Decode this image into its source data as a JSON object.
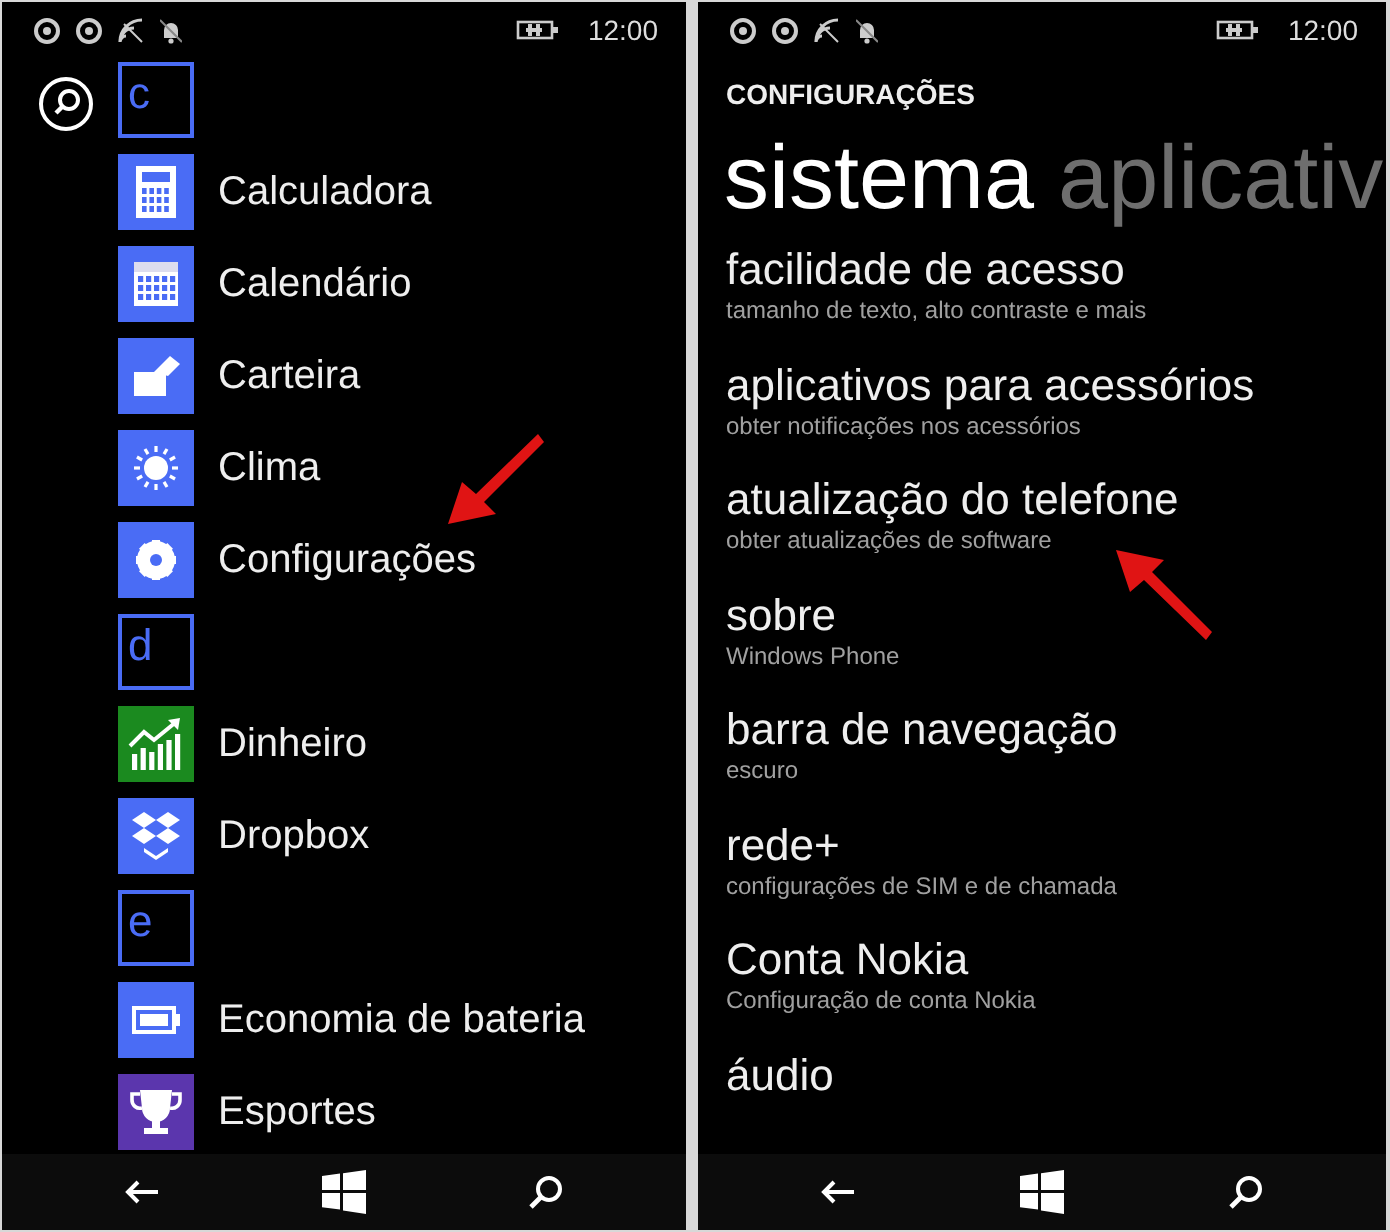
{
  "app_list_screen": {
    "status_bar": {
      "time": "12:00"
    },
    "apps": [
      {
        "kind": "letter",
        "label": "c",
        "color": "#4a6cf5"
      },
      {
        "kind": "app",
        "label": "Calculadora",
        "color": "#4a6cf5",
        "arrow": false
      },
      {
        "kind": "app",
        "label": "Calendário",
        "color": "#4a6cf5",
        "arrow": false
      },
      {
        "kind": "app",
        "label": "Carteira",
        "color": "#4a6cf5",
        "arrow": false
      },
      {
        "kind": "app",
        "label": "Clima",
        "color": "#4a6cf5",
        "arrow": false
      },
      {
        "kind": "app",
        "label": "Configurações",
        "color": "#4a6cf5",
        "arrow": true
      },
      {
        "kind": "letter",
        "label": "d",
        "color": "#4a6cf5"
      },
      {
        "kind": "app",
        "label": "Dinheiro",
        "color": "#1b8a1f",
        "arrow": false
      },
      {
        "kind": "app",
        "label": "Dropbox",
        "color": "#4a6cf5",
        "arrow": false
      },
      {
        "kind": "letter",
        "label": "e",
        "color": "#4a6cf5"
      },
      {
        "kind": "app",
        "label": "Economia de bateria",
        "color": "#4a6cf5",
        "arrow": false
      },
      {
        "kind": "app",
        "label": "Esportes",
        "color": "#5b36ad",
        "arrow": false
      }
    ]
  },
  "settings_screen": {
    "status_bar": {
      "time": "12:00"
    },
    "title": "CONFIGURAÇÕES",
    "pivots": [
      {
        "label": "sistema",
        "selected": true
      },
      {
        "label": "aplicativ",
        "selected": false
      }
    ],
    "items": [
      {
        "title": "facilidade de acesso",
        "subtitle": "tamanho de texto, alto contraste e mais",
        "arrow": false
      },
      {
        "title": "aplicativos para acessórios",
        "subtitle": "obter notificações nos acessórios",
        "arrow": false
      },
      {
        "title": "atualização do telefone",
        "subtitle": "obter atualizações de software",
        "arrow": true
      },
      {
        "title": "sobre",
        "subtitle": "Windows Phone",
        "arrow": false
      },
      {
        "title": "barra de navegação",
        "subtitle": "escuro",
        "arrow": false
      },
      {
        "title": "rede+",
        "subtitle": "configurações de SIM e de chamada",
        "arrow": false
      },
      {
        "title": "Conta Nokia",
        "subtitle": "Configuração de conta Nokia",
        "arrow": false
      },
      {
        "title": "áudio",
        "arrow": false
      }
    ]
  }
}
